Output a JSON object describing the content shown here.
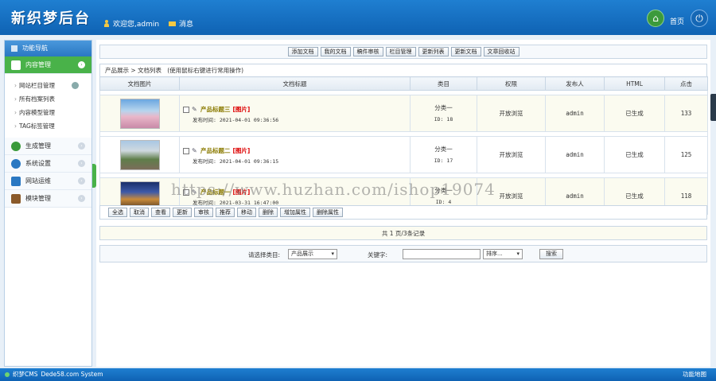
{
  "header": {
    "logo": "新织梦后台",
    "welcome": "欢迎您,admin",
    "messages": "消息",
    "home": "首页"
  },
  "sidebar": {
    "title": "功能导航",
    "groups": [
      {
        "label": "内容管理",
        "active": true,
        "color": "#49b249"
      },
      {
        "label": "生成管理",
        "active": false,
        "color": "#3a9a3a"
      },
      {
        "label": "系统设置",
        "active": false,
        "color": "#2a78c2"
      },
      {
        "label": "网站运维",
        "active": false,
        "color": "#2a78c2"
      },
      {
        "label": "模块管理",
        "active": false,
        "color": "#8a5a2a"
      }
    ],
    "sub_items": [
      "网站栏目管理",
      "所有档案列表",
      "内容模型管理",
      "TAG标签管理"
    ]
  },
  "toolbar": {
    "buttons": [
      "添加文档",
      "我的文档",
      "稿件审核",
      "栏目管理",
      "更新列表",
      "更新文档",
      "文章回收站"
    ]
  },
  "crumb": {
    "path": "产品展示 > 文档列表",
    "hint": "(使用鼠标右键进行常用操作)"
  },
  "table": {
    "headers": [
      "文档图片",
      "文档标题",
      "类目",
      "权限",
      "发布人",
      "HTML",
      "点击"
    ],
    "rows": [
      {
        "title": "产品标题三",
        "tag": "[图片]",
        "time": "发布时间: 2021-04-01 09:36:56",
        "category": "分类一",
        "id": "ID: 18",
        "permission": "开放浏览",
        "publisher": "admin",
        "html": "已生成",
        "clicks": "133"
      },
      {
        "title": "产品标题二",
        "tag": "[图片]",
        "time": "发布时间: 2021-04-01 09:36:15",
        "category": "分类一",
        "id": "ID: 17",
        "permission": "开放浏览",
        "publisher": "admin",
        "html": "已生成",
        "clicks": "125"
      },
      {
        "title": "产品标题一",
        "tag": "[图片]",
        "time": "发布时间: 2021-03-31 16:47:00",
        "category": "分类一",
        "id": "ID: 4",
        "permission": "开放浏览",
        "publisher": "admin",
        "html": "已生成",
        "clicks": "118"
      }
    ]
  },
  "ops": {
    "buttons": [
      "全选",
      "取消",
      "查看",
      "更新",
      "审核",
      "推荐",
      "移动",
      "删除",
      "增加属性",
      "删除属性"
    ]
  },
  "pager": {
    "text": "共 1 页/3条记录"
  },
  "search": {
    "category_label": "请选择类目:",
    "category_value": "产品展示",
    "keyword_label": "关键字:",
    "sort_value": "排序...",
    "button": "搜索"
  },
  "watermark": "https://www.huzhan.com/ishop19074",
  "footer": {
    "left": "织梦CMS",
    "system": "Dede58.com System",
    "right": "功能地图"
  }
}
